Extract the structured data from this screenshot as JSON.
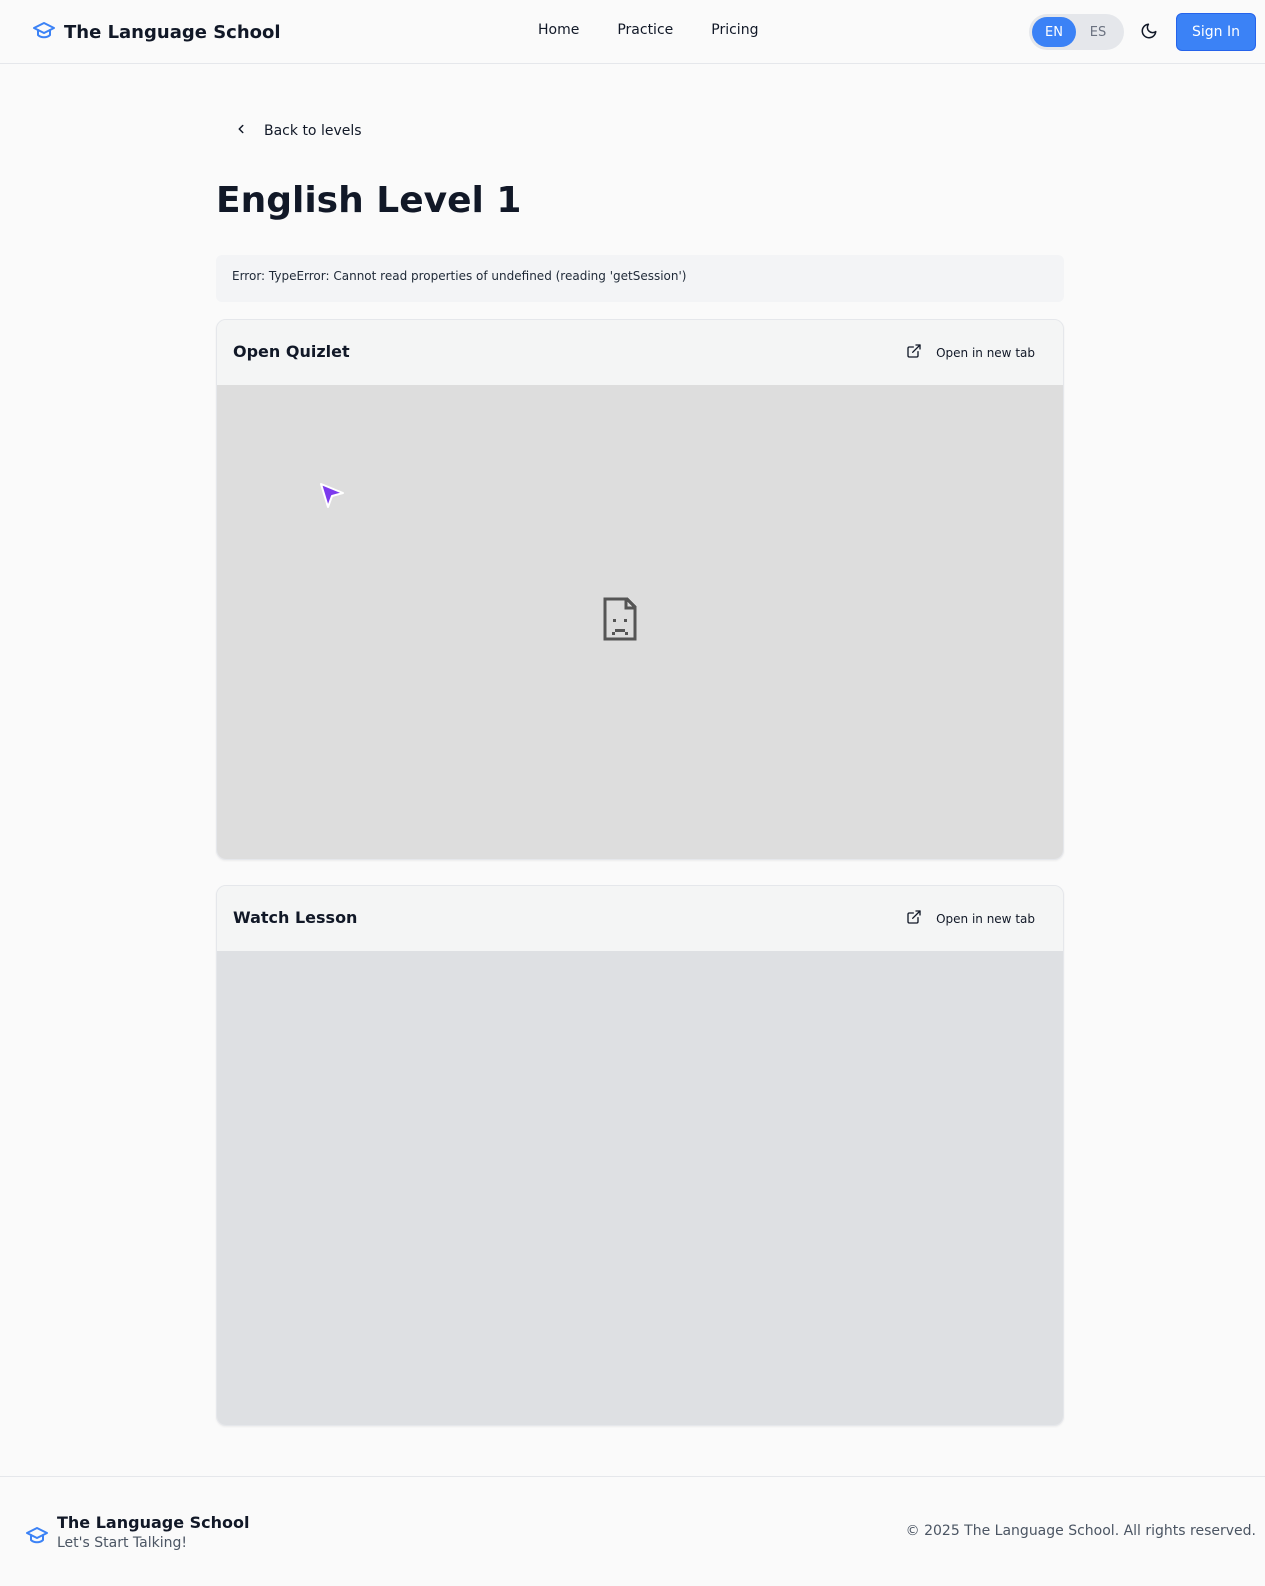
{
  "header": {
    "brand": "The Language School",
    "nav": [
      "Home",
      "Practice",
      "Pricing"
    ],
    "languages": [
      "EN",
      "ES"
    ],
    "active_language": "EN",
    "sign_in": "Sign In"
  },
  "main": {
    "back_label": "Back to levels",
    "title": "English Level 1",
    "error": "Error: TypeError: Cannot read properties of undefined (reading 'getSession')",
    "cards": [
      {
        "title": "Open Quizlet",
        "open_label": "Open in new tab"
      },
      {
        "title": "Watch Lesson",
        "open_label": "Open in new tab"
      }
    ]
  },
  "footer": {
    "brand": "The Language School",
    "tagline": "Let's Start Talking!",
    "copyright": "© 2025 The Language School. All rights reserved."
  },
  "colors": {
    "accent": "#3b82f6",
    "cursor": "#7c3aed"
  }
}
